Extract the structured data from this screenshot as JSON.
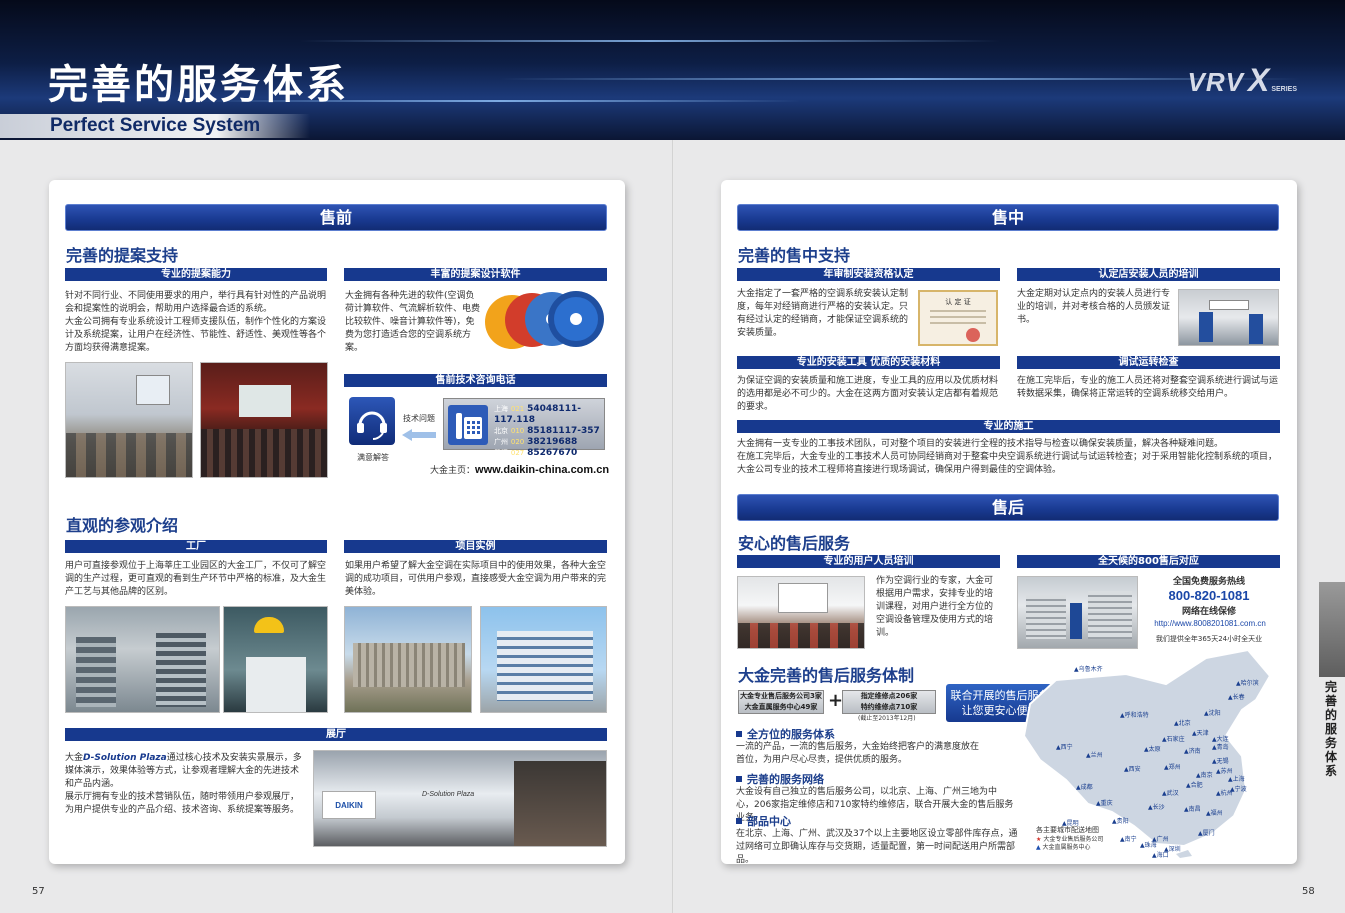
{
  "header": {
    "title": "完善的服务体系",
    "subtitle": "Perfect Service System",
    "logo_vrv": "VRV",
    "logo_x": "X",
    "logo_series": "SERIES"
  },
  "left": {
    "band": "售前",
    "proposal": {
      "title": "完善的提案支持",
      "bar1": "专业的提案能力",
      "text1": [
        "针对不同行业、不同使用要求的用户，举行具有针对性的产品说明会和提案性的说明会，帮助用户选择最合适的系统。",
        "大金公司拥有专业系统设计工程师支援队伍，制作个性化的方案设计及系统提案，让用户在经济性、节能性、舒适性、美观性等各个方面均获得满意提案。"
      ],
      "bar2": "丰富的提案设计软件",
      "text2": "大金拥有各种先进的软件(空调负荷计算软件、气流解析软件、电费比较软件、噪音计算软件等)，免费为您打造适合您的空调系统方案。",
      "bar3": "售前技术咨询电话",
      "tech_label": "技术问题",
      "satisfied": "满意解答",
      "phones": [
        {
          "city": "上海",
          "code": "021",
          "num": "54048111-117.118"
        },
        {
          "city": "北京",
          "code": "010",
          "num": "85181117-357"
        },
        {
          "city": "广州",
          "code": "020",
          "num": "38219688"
        },
        {
          "city": "武汉",
          "code": "027",
          "num": "85267670"
        }
      ],
      "site_label": "大金主页：",
      "site": "www.daikin-china.com.cn"
    },
    "reference": {
      "title": "直观的参观介绍",
      "bar_factory": "工厂",
      "factory_text": "用户可直接参观位于上海莘庄工业园区的大金工厂，不仅可了解空调的生产过程，更可直观的看到生产环节中严格的标准，及大金生产工艺与其他品牌的区别。",
      "bar_project": "项目实例",
      "project_text": "如果用户希望了解大金空调在实际项目中的使用效果，各种大金空调的成功项目，可供用户参观，直接感受大金空调为用户带来的完美体验。",
      "bar_hall": "展厅",
      "hall_prefix": "大金",
      "hall_brand": "D-Solution Plaza",
      "hall_text1": "通过核心技术及安装实景展示，多媒体演示，效果体验等方式，让参观者理解大金的先进技术和产品内涵。",
      "hall_text2": "展示厅拥有专业的技术营销队伍，随时带领用户参观展厅，为用户提供专业的产品介绍、技术咨询、系统提案等服务。",
      "hall_sign": "D-Solution Plaza",
      "hall_logo": "DAIKIN"
    },
    "page_number": "57"
  },
  "right": {
    "band_mid": "售中",
    "mid": {
      "title": "完善的售中支持",
      "bar1": "年审制安装资格认定",
      "text1": "大金指定了一套严格的空调系统安装认定制度，每年对经销商进行严格的安装认定。只有经过认定的经销商，才能保证空调系统的安装质量。",
      "cert": "认 定 证",
      "bar2": "认定店安装人员的培训",
      "text2": "大金定期对认定点内的安装人员进行专业的培训，并对考核合格的人员颁发证书。",
      "bar3": "专业的安装工具 优质的安装材料",
      "text3": "为保证空调的安装质量和施工进度，专业工具的应用以及优质材料的选用都是必不可少的。大金在这两方面对安装认定店都有着规范的要求。",
      "bar4": "调试运转检查",
      "text4": "在施工完毕后，专业的施工人员还将对整套空调系统进行调试与运转数据采集，确保将正常运转的空调系统移交给用户。",
      "bar5": "专业的施工",
      "text5": [
        "大金拥有一支专业的工事技术团队，可对整个项目的安装进行全程的技术指导与检查以确保安装质量，解决各种疑难问题。",
        "在施工完毕后，大金专业的工事技术人员可协同经销商对于整套中央空调系统进行调试与试运转检查；对于采用智能化控制系统的项目，",
        "大金公司专业的技术工程师将直接进行现场调试，确保用户得到最佳的空调体验。"
      ]
    },
    "band_after": "售后",
    "after": {
      "title": "安心的售后服务",
      "bar1": "专业的用户人员培训",
      "text1": "作为空调行业的专家，大金可根据用户需求，安排专业的培训课程，对用户进行全方位的空调设备管理及使用方式的培训。",
      "bar2": "全天候的800售后对应",
      "hotline_label": "全国免费服务热线",
      "hotline": "800-820-1081",
      "online_label": "网络在线保修",
      "online_url": "http://www.8008201081.com.cn",
      "allyear": "我们提供全年365天24小时全天业",
      "system_title": "大金完善的售后服务体制",
      "box1_line1": "大金专业售后服务公司3家",
      "box1_line2": "大金直属服务中心49家",
      "plus": "+",
      "box2_line1": "指定维修点206家",
      "box2_line2": "特约维修点710家",
      "box2_note": "(截止至2013年12月)",
      "callout1": "联合开展的售后服务",
      "callout2": "让您更安心便捷",
      "b1": "全方位的服务体系",
      "b1_text": "一流的产品，一流的售后服务，大金始终把客户的满意度放在首位，为用户尽心尽责，提供优质的服务。",
      "b2": "完善的服务网络",
      "b2_text": "大金设有自己独立的售后服务公司，以北京、上海、广州三地为中心，206家指定维修店和710家特约维修店，联合开展大金的售后服务业务。",
      "b3": "部品中心",
      "b3_text": "在北京、上海、广州、武汉及37个以上主要地区设立零部件库存点，通过网络可立即确认库存与交货期，适量配置，第一时间配送用户所需部品。",
      "map_legend_title": "各主要城市配送地图",
      "map_legend1": "大金专业售后服务公司",
      "map_legend2": "大金直属服务中心",
      "map_cities": [
        "乌鲁木齐",
        "哈尔滨",
        "长春",
        "沈阳",
        "呼和浩特",
        "北京",
        "天津",
        "大连",
        "石家庄",
        "济南",
        "青岛",
        "西宁",
        "兰州",
        "太原",
        "郑州",
        "西安",
        "南京",
        "上海",
        "合肥",
        "杭州",
        "武汉",
        "成都",
        "重庆",
        "长沙",
        "南昌",
        "福州",
        "贵阳",
        "昆明",
        "南宁",
        "广州",
        "深圳",
        "厦门",
        "海口",
        "珠海",
        "宁波",
        "苏州",
        "无锡"
      ]
    },
    "side_tab": "完善的服务体系",
    "page_number": "58"
  }
}
